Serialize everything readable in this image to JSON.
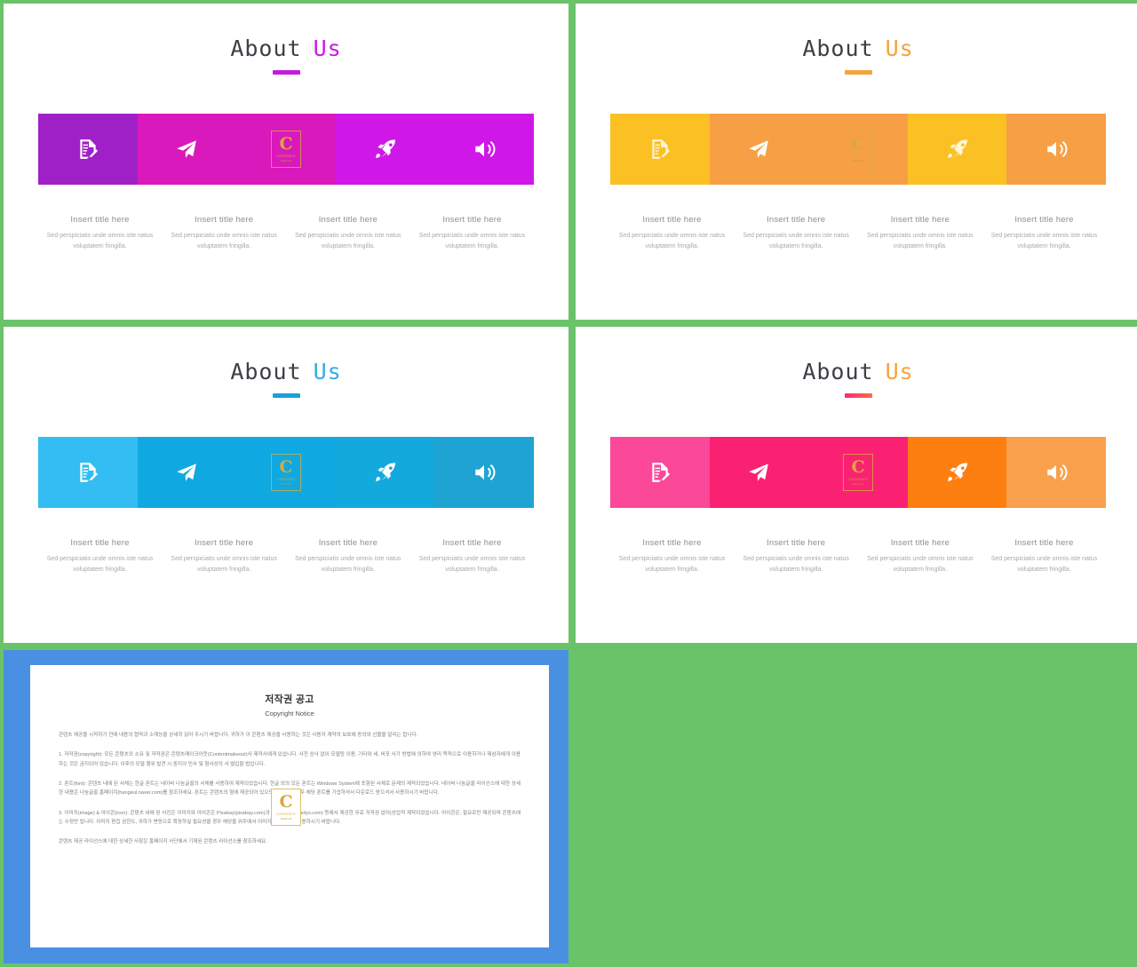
{
  "background_color": "#6ac368",
  "watermark": {
    "letter": "C",
    "line1": "CONTENTS",
    "line2": "DESIGN"
  },
  "common": {
    "title_prefix": "About",
    "title_accent": "Us",
    "caption_title": "Insert title here",
    "caption_body": "Sed perspiciatis unde omnis iste natus voluptatem fringilla."
  },
  "slides": [
    {
      "id": "slide-purple",
      "accent_color": "#c71ae0",
      "bar_color": "#c71ae0",
      "segments": [
        {
          "icon": "document-edit-icon",
          "color": "#a020c8"
        },
        {
          "icon": "paper-plane-icon",
          "color": "#d919bb"
        },
        {
          "icon": "center-logo-slot",
          "color": "#d919bb"
        },
        {
          "icon": "rocket-icon",
          "color": "#cf17e8"
        },
        {
          "icon": "speaker-icon",
          "color": "#cf17e8"
        }
      ]
    },
    {
      "id": "slide-orange",
      "accent_color": "#f5a33c",
      "bar_color": "#f5a33c",
      "segments": [
        {
          "icon": "document-edit-icon",
          "color": "#fbc024"
        },
        {
          "icon": "paper-plane-icon",
          "color": "#f79f45"
        },
        {
          "icon": "center-logo-slot",
          "color": "#f79f45"
        },
        {
          "icon": "rocket-icon",
          "color": "#fbc024"
        },
        {
          "icon": "speaker-icon",
          "color": "#f79f45"
        }
      ]
    },
    {
      "id": "slide-blue",
      "accent_color": "#31aee0",
      "bar_color": "#31aee0",
      "segments": [
        {
          "icon": "document-edit-icon",
          "color": "#33bdf2"
        },
        {
          "icon": "paper-plane-icon",
          "color": "#10a8e0"
        },
        {
          "icon": "center-logo-slot",
          "color": "#10a8e0"
        },
        {
          "icon": "rocket-icon",
          "color": "#13a9dd"
        },
        {
          "icon": "speaker-icon",
          "color": "#1fa3d2"
        }
      ]
    },
    {
      "id": "slide-pink",
      "accent_color": "#f5a33c",
      "bar_color": "#fb4a6e",
      "segments": [
        {
          "icon": "document-edit-icon",
          "color": "#fb4899"
        },
        {
          "icon": "paper-plane-icon",
          "color": "#fb2172"
        },
        {
          "icon": "center-logo-slot",
          "color": "#fb2172"
        },
        {
          "icon": "rocket-icon",
          "color": "#fc7f10"
        },
        {
          "icon": "speaker-icon",
          "color": "#f9a04d"
        }
      ]
    }
  ],
  "copyright": {
    "frame_color": "#4a90e2",
    "title": "저작권 공고",
    "subtitle": "Copyright Notice",
    "paragraphs": [
      "콘텐츠 제공을 시작하기 전에 내용의 협약과 소재능을 상세히 읽어 주시기 바랍니다. 귀하가 이 콘텐츠 제공을 사용하는 것은 사용자 계약의 보호에 동의와 선물을 알리는 합니다.",
      "1. 저작권(copyright): 모든 콘텐츠의 소유 및 저작권은 콘텐츠메이크아웃(Contentmakeout)사 제작사에게 있습니다. 사전 승낙 없이 모델링 이용, 기타와 세, 비포 사기 방법에 의하여 영리 목적으로 이용하거나 제삼자에게 이용하는 것은 금지되어 있습니다. 이후의 모델 행위 발견 시 중지의 민사 및 형사상의 사 벌입할 법입니다.",
      "2. 폰트(font): 콘텐츠 내에 된 서체는 한글 폰트는 네이버 나눔글꼴의 서체를 사용하여 제작되었습니다. 한글 외의 모든 폰트는 Windows System에 포함된 서체로 문제의 제작되었습니다. 네이버 나눔글꼴 라이선스에 대한 상세한 내용은 나눔글꼴 홈페이지(hangeul.naver.com)를 참조하세요. 폰트는 콘텐츠의 형에 제공되어 있으므로, 필요할 경우 해당 폰트를 기업하셔서 다운로드 받으셔서 사용하시기 바랍니다.",
      "3. 이미지(image) & 아이콘(icon): 콘텐츠 내에 된 사진은 이미지와 아이콘은 Pixabay(pixabay.com)과 Weboly's(webolys.com) 등에서 제공한 무료 저작권 없이(상업적 제작되었습니다. 아이콘은, 필요로만 제공되며 콘텐츠에는 수정만 됩니다. 이미지 편집 권한도, 귀하가 변동으로 확장하실 필요성을 경우 해당을 위주에서 이미지를 변경하여 사용하시기 바랍니다.",
      "콘텐츠 제공 라이선스에 대한 상세한 사항은 홈페이지 사단에서 기재된 콘텐츠 라이선스를 참조하세요."
    ]
  }
}
